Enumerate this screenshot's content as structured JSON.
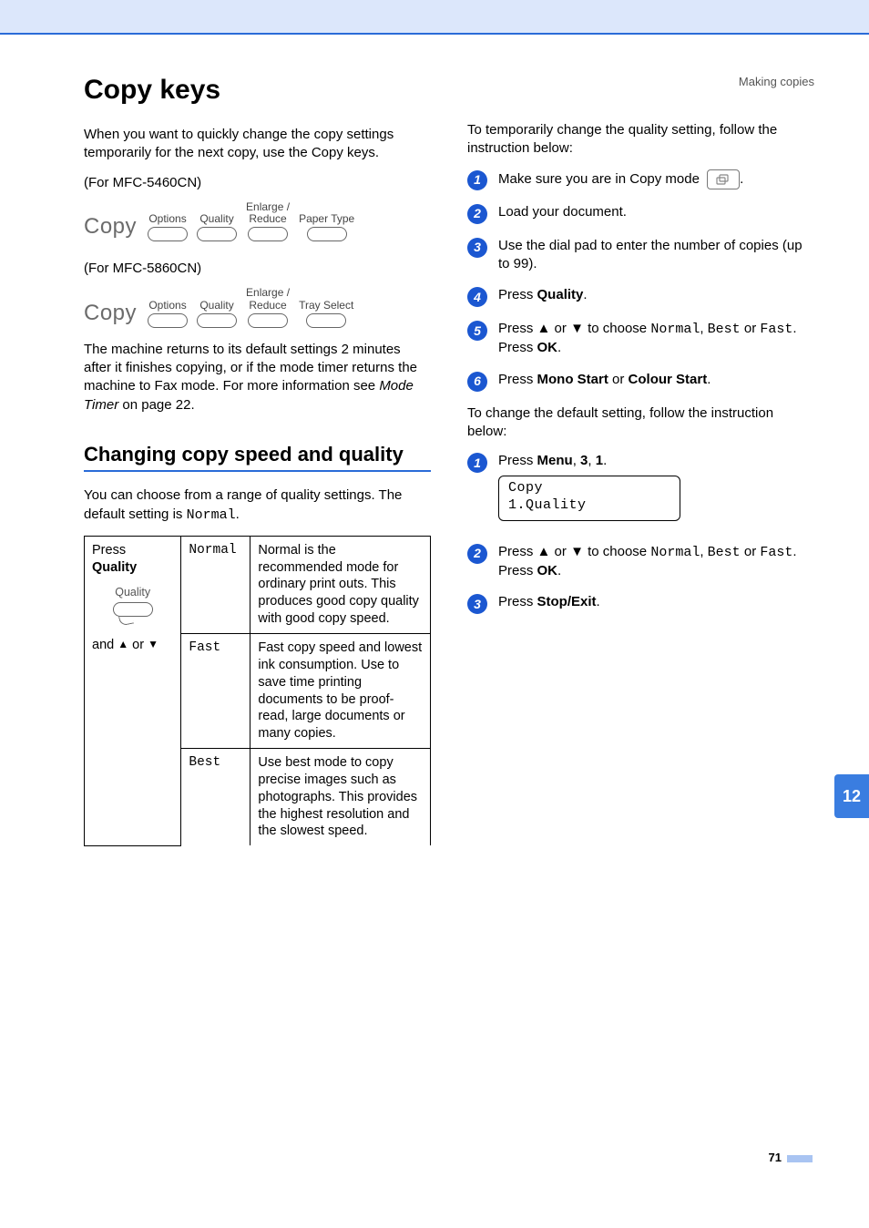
{
  "breadcrumb": "Making copies",
  "sideTab": "12",
  "pageNumber": "71",
  "left": {
    "h1": "Copy keys",
    "intro": "When you want to quickly change the copy settings temporarily for the next copy, use the Copy keys.",
    "model1_note": "(For MFC-5460CN)",
    "model2_note": "(For MFC-5860CN)",
    "copyWord": "Copy",
    "panel1": {
      "k1": "Options",
      "k2": "Quality",
      "k3a": "Enlarge /",
      "k3b": "Reduce",
      "k4": "Paper Type"
    },
    "panel2": {
      "k1": "Options",
      "k2": "Quality",
      "k3a": "Enlarge /",
      "k3b": "Reduce",
      "k4": "Tray Select"
    },
    "returnDefault_a": "The machine returns to its default settings 2 minutes after it finishes copying, or if the mode timer returns the machine to Fax mode. For more information see ",
    "returnDefault_link": "Mode Timer",
    "returnDefault_b": " on page 22.",
    "h2": "Changing copy speed and quality",
    "qualityIntro_a": "You can choose from a range of quality settings. The default setting is ",
    "qualityIntro_mono": "Normal",
    "qualityIntro_b": ".",
    "table": {
      "pressA": "Press ",
      "pressBold": "Quality",
      "keyLabel": "Quality",
      "andArrows_a": "and ",
      "andArrows_b": " or ",
      "r1_opt": "Normal",
      "r1_desc": "Normal is the recommended mode for ordinary print outs. This produces good copy quality with good copy speed.",
      "r2_opt": "Fast",
      "r2_desc": "Fast copy speed and lowest ink consumption. Use to save time printing documents to be proof-read, large documents or many copies.",
      "r3_opt": "Best",
      "r3_desc": "Use best mode to copy precise images such as photographs. This provides the highest resolution and the slowest speed."
    }
  },
  "right": {
    "tempIntro": "To temporarily change the quality setting, follow the instruction below:",
    "s1_a": "Make sure you are in Copy mode ",
    "s1_b": ".",
    "s2": "Load your document.",
    "s3": "Use the dial pad to enter the number of copies (up to 99).",
    "s4_a": "Press ",
    "s4_b": "Quality",
    "s4_c": ".",
    "s5_a": "Press ",
    "s5_b": " or ",
    "s5_c": " to choose ",
    "s5_m1": "Normal",
    "s5_d": ", ",
    "s5_m2": "Best",
    "s5_e": " or ",
    "s5_m3": "Fast",
    "s5_f": ". Press ",
    "s5_ok": "OK",
    "s5_g": ".",
    "s6_a": "Press ",
    "s6_b": "Mono Start",
    "s6_c": " or ",
    "s6_d": "Colour Start",
    "s6_e": ".",
    "defaultIntro": "To change the default setting, follow the instruction below:",
    "d1_a": "Press ",
    "d1_b": "Menu",
    "d1_c": ", ",
    "d1_d": "3",
    "d1_e": ", ",
    "d1_f": "1",
    "d1_g": ".",
    "lcd_l1": "Copy",
    "lcd_l2": "1.Quality",
    "d2_a": "Press ",
    "d2_b": " or ",
    "d2_c": " to choose ",
    "d2_m1": "Normal",
    "d2_d": ", ",
    "d2_m2": "Best",
    "d2_e": " or ",
    "d2_m3": "Fast",
    "d2_f": ". Press ",
    "d2_ok": "OK",
    "d2_g": ".",
    "d3_a": "Press ",
    "d3_b": "Stop/Exit",
    "d3_c": "."
  }
}
